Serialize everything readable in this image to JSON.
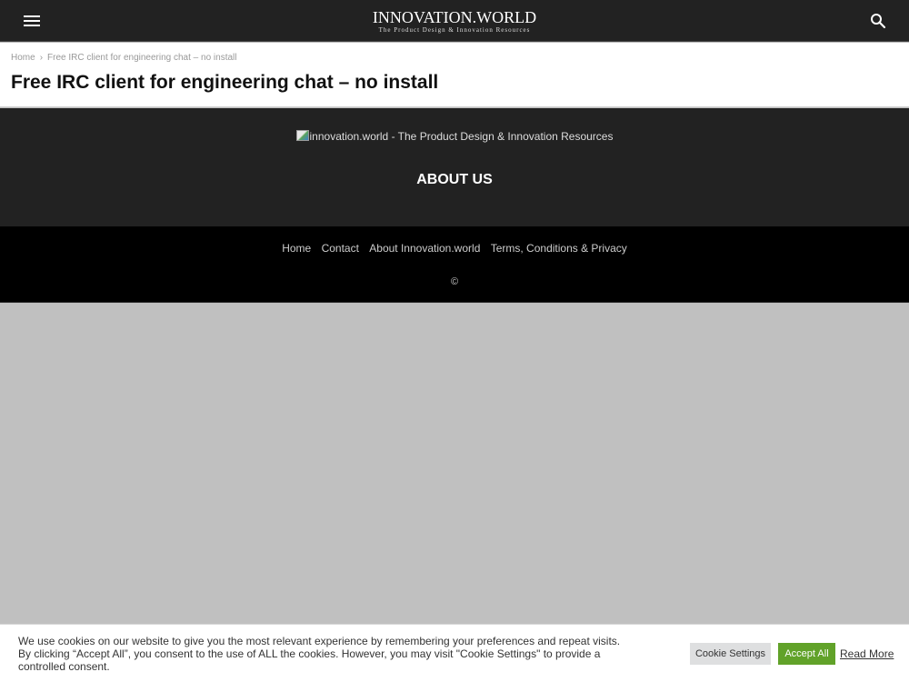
{
  "topbar": {
    "menu_icon": "hamburger-menu-icon",
    "site_title": "INNOVATION.WORLD",
    "site_tagline": "The Product Design & Innovation Resources",
    "search_icon": "search-icon"
  },
  "breadcrumb": {
    "home": "Home",
    "separator": "›",
    "current": "Free IRC client for engineering chat – no install"
  },
  "page": {
    "title": "Free IRC client for engineering chat – no install"
  },
  "footer": {
    "logo_alt": "innovation.world - The Product Design & Innovation Resources",
    "about_heading": "ABOUT US",
    "menu": [
      {
        "label": "Home"
      },
      {
        "label": "Contact"
      },
      {
        "label": "About Innovation.world"
      },
      {
        "label": "Terms, Conditions & Privacy"
      }
    ],
    "copyright": "©"
  },
  "cookie": {
    "text": "We use cookies on our website to give you the most relevant experience by remembering your preferences and repeat visits. By clicking “Accept All”, you consent to the use of ALL the cookies. However, you may visit \"Cookie Settings\" to provide a controlled consent.",
    "settings_label": "Cookie Settings",
    "accept_label": "Accept All",
    "read_more_label": "Read More",
    "accept_color": "#61a229"
  },
  "colors": {
    "topbar_bg": "#222222",
    "footer_top_bg": "#222222",
    "footer_bottom_bg": "#000000",
    "overlay_bg": "#c0c0c0"
  }
}
